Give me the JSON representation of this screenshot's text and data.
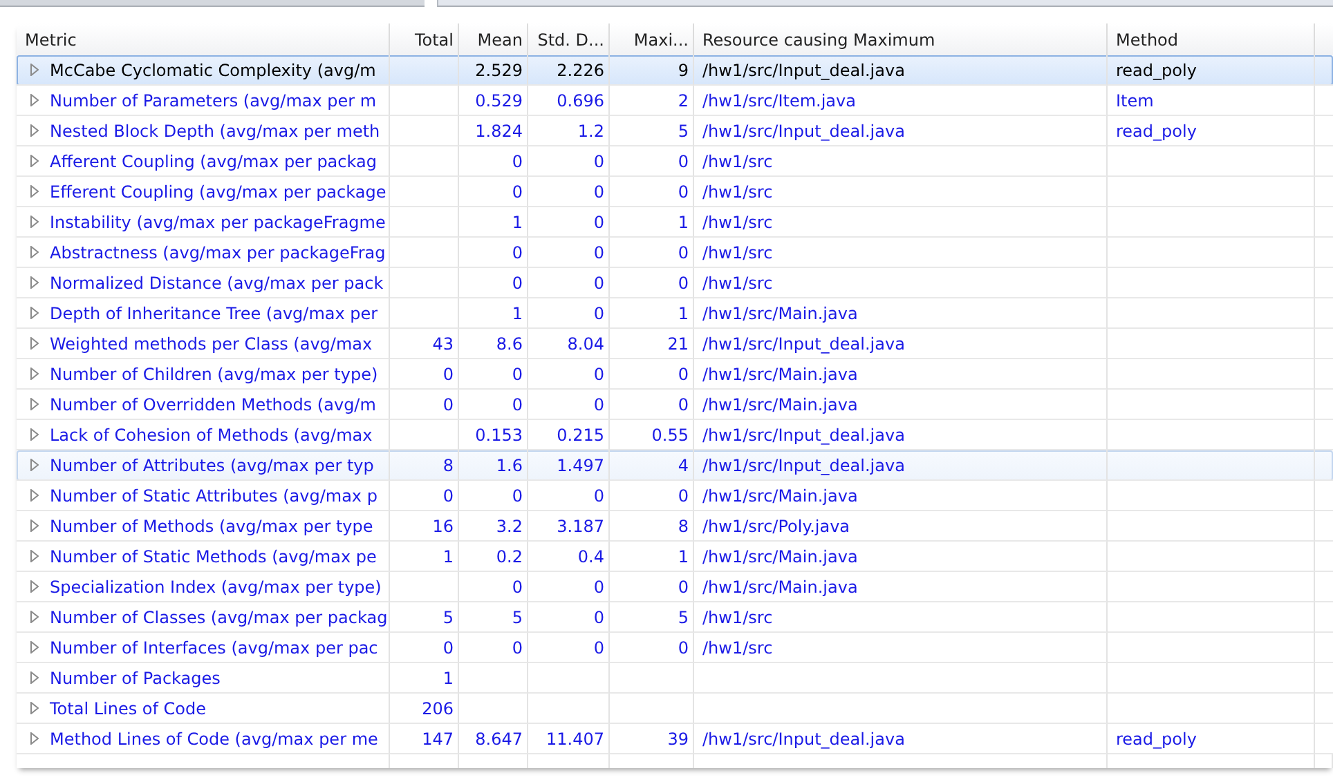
{
  "table": {
    "columns": [
      "Metric",
      "Total",
      "Mean",
      "Std. D...",
      "Maxi...",
      "Resource causing Maximum",
      "Method"
    ],
    "rows": [
      {
        "metric": "McCabe Cyclomatic Complexity (avg/m",
        "mean": "2.529",
        "std_dev": "2.226",
        "maximum": "9",
        "resource": "/hw1/src/Input_deal.java",
        "method": "read_poly",
        "selected": true,
        "hovered": false
      },
      {
        "metric": "Number of Parameters (avg/max per m",
        "mean": "0.529",
        "std_dev": "0.696",
        "maximum": "2",
        "resource": "/hw1/src/Item.java",
        "method": "Item",
        "selected": false,
        "hovered": false
      },
      {
        "metric": "Nested Block Depth (avg/max per meth",
        "mean": "1.824",
        "std_dev": "1.2",
        "maximum": "5",
        "resource": "/hw1/src/Input_deal.java",
        "method": "read_poly",
        "selected": false,
        "hovered": false
      },
      {
        "metric": "Afferent Coupling (avg/max per packag",
        "mean": "0",
        "std_dev": "0",
        "maximum": "0",
        "resource": "/hw1/src",
        "selected": false,
        "hovered": false
      },
      {
        "metric": "Efferent Coupling (avg/max per package",
        "mean": "0",
        "std_dev": "0",
        "maximum": "0",
        "resource": "/hw1/src",
        "selected": false,
        "hovered": false
      },
      {
        "metric": "Instability (avg/max per packageFragme",
        "mean": "1",
        "std_dev": "0",
        "maximum": "1",
        "resource": "/hw1/src",
        "selected": false,
        "hovered": false
      },
      {
        "metric": "Abstractness (avg/max per packageFrag",
        "mean": "0",
        "std_dev": "0",
        "maximum": "0",
        "resource": "/hw1/src",
        "selected": false,
        "hovered": false
      },
      {
        "metric": "Normalized Distance (avg/max per pack",
        "mean": "0",
        "std_dev": "0",
        "maximum": "0",
        "resource": "/hw1/src",
        "selected": false,
        "hovered": false
      },
      {
        "metric": "Depth of Inheritance Tree (avg/max per",
        "mean": "1",
        "std_dev": "0",
        "maximum": "1",
        "resource": "/hw1/src/Main.java",
        "selected": false,
        "hovered": false
      },
      {
        "metric": "Weighted methods per Class (avg/max",
        "total": "43",
        "mean": "8.6",
        "std_dev": "8.04",
        "maximum": "21",
        "resource": "/hw1/src/Input_deal.java",
        "selected": false,
        "hovered": false
      },
      {
        "metric": "Number of Children (avg/max per type)",
        "total": "0",
        "mean": "0",
        "std_dev": "0",
        "maximum": "0",
        "resource": "/hw1/src/Main.java",
        "selected": false,
        "hovered": false
      },
      {
        "metric": "Number of Overridden Methods (avg/m",
        "total": "0",
        "mean": "0",
        "std_dev": "0",
        "maximum": "0",
        "resource": "/hw1/src/Main.java",
        "selected": false,
        "hovered": false
      },
      {
        "metric": "Lack of Cohesion of Methods (avg/max",
        "mean": "0.153",
        "std_dev": "0.215",
        "maximum": "0.55",
        "resource": "/hw1/src/Input_deal.java",
        "selected": false,
        "hovered": false
      },
      {
        "metric": "Number of Attributes (avg/max per typ",
        "total": "8",
        "mean": "1.6",
        "std_dev": "1.497",
        "maximum": "4",
        "resource": "/hw1/src/Input_deal.java",
        "selected": false,
        "hovered": true
      },
      {
        "metric": "Number of Static Attributes (avg/max p",
        "total": "0",
        "mean": "0",
        "std_dev": "0",
        "maximum": "0",
        "resource": "/hw1/src/Main.java",
        "selected": false,
        "hovered": false
      },
      {
        "metric": "Number of Methods (avg/max per type",
        "total": "16",
        "mean": "3.2",
        "std_dev": "3.187",
        "maximum": "8",
        "resource": "/hw1/src/Poly.java",
        "selected": false,
        "hovered": false
      },
      {
        "metric": "Number of Static Methods (avg/max pe",
        "total": "1",
        "mean": "0.2",
        "std_dev": "0.4",
        "maximum": "1",
        "resource": "/hw1/src/Main.java",
        "selected": false,
        "hovered": false
      },
      {
        "metric": "Specialization Index (avg/max per type)",
        "mean": "0",
        "std_dev": "0",
        "maximum": "0",
        "resource": "/hw1/src/Main.java",
        "selected": false,
        "hovered": false
      },
      {
        "metric": "Number of Classes (avg/max per packag",
        "total": "5",
        "mean": "5",
        "std_dev": "0",
        "maximum": "5",
        "resource": "/hw1/src",
        "selected": false,
        "hovered": false
      },
      {
        "metric": "Number of Interfaces (avg/max per pac",
        "total": "0",
        "mean": "0",
        "std_dev": "0",
        "maximum": "0",
        "resource": "/hw1/src",
        "selected": false,
        "hovered": false
      },
      {
        "metric": "Number of Packages",
        "total": "1",
        "selected": false,
        "hovered": false
      },
      {
        "metric": "Total Lines of Code",
        "total": "206",
        "selected": false,
        "hovered": false
      },
      {
        "metric": "Method Lines of Code (avg/max per me",
        "total": "147",
        "mean": "8.647",
        "std_dev": "11.407",
        "maximum": "39",
        "resource": "/hw1/src/Input_deal.java",
        "method": "read_poly",
        "selected": false,
        "hovered": false
      }
    ]
  }
}
